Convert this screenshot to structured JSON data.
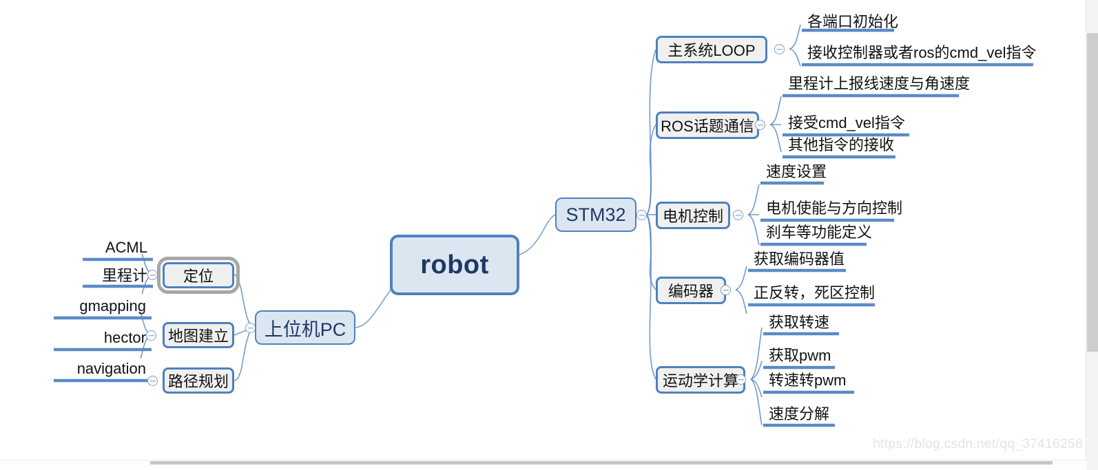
{
  "diagram": {
    "title": "robot",
    "watermark": "https://blog.csdn.net/qq_37416258",
    "colors": {
      "root_fill": "#dce6f1",
      "root_border": "#4e81bd",
      "node_fill": "#f0f0f0",
      "node_border": "#4e81bd",
      "branch_line": "#4e81bd",
      "root_text": "#1f3864",
      "selection_outline": "#a6a6a6"
    }
  },
  "root": {
    "label": "robot"
  },
  "branches": {
    "right": {
      "label": "STM32"
    },
    "left": {
      "label": "上位机PC"
    }
  },
  "stm32_children": [
    {
      "label": "主系统LOOP",
      "leaves": [
        "各端口初始化",
        "接收控制器或者ros的cmd_vel指令"
      ]
    },
    {
      "label": "ROS话题通信",
      "leaves": [
        "里程计上报线速度与角速度",
        "接受cmd_vel指令",
        "其他指令的接收"
      ]
    },
    {
      "label": "电机控制",
      "leaves": [
        "速度设置",
        "电机使能与方向控制",
        "刹车等功能定义"
      ]
    },
    {
      "label": "编码器",
      "leaves": [
        "获取编码器值",
        "正反转，死区控制"
      ]
    },
    {
      "label": "运动学计算",
      "leaves": [
        "获取转速",
        "获取pwm",
        "转速转pwm",
        "速度分解"
      ]
    }
  ],
  "pc_children": [
    {
      "label": "定位",
      "selected": true,
      "leaves": [
        "ACML",
        "里程计"
      ]
    },
    {
      "label": "地图建立",
      "selected": false,
      "leaves": [
        "gmapping",
        "hector"
      ]
    },
    {
      "label": "路径规划",
      "selected": false,
      "leaves": [
        "navigation"
      ]
    }
  ],
  "toggles": {
    "icon": "collapse-minus-icon"
  },
  "scrollbars": {
    "vertical": {
      "name": "vertical-scrollbar"
    },
    "horizontal": {
      "name": "horizontal-scrollbar"
    }
  }
}
